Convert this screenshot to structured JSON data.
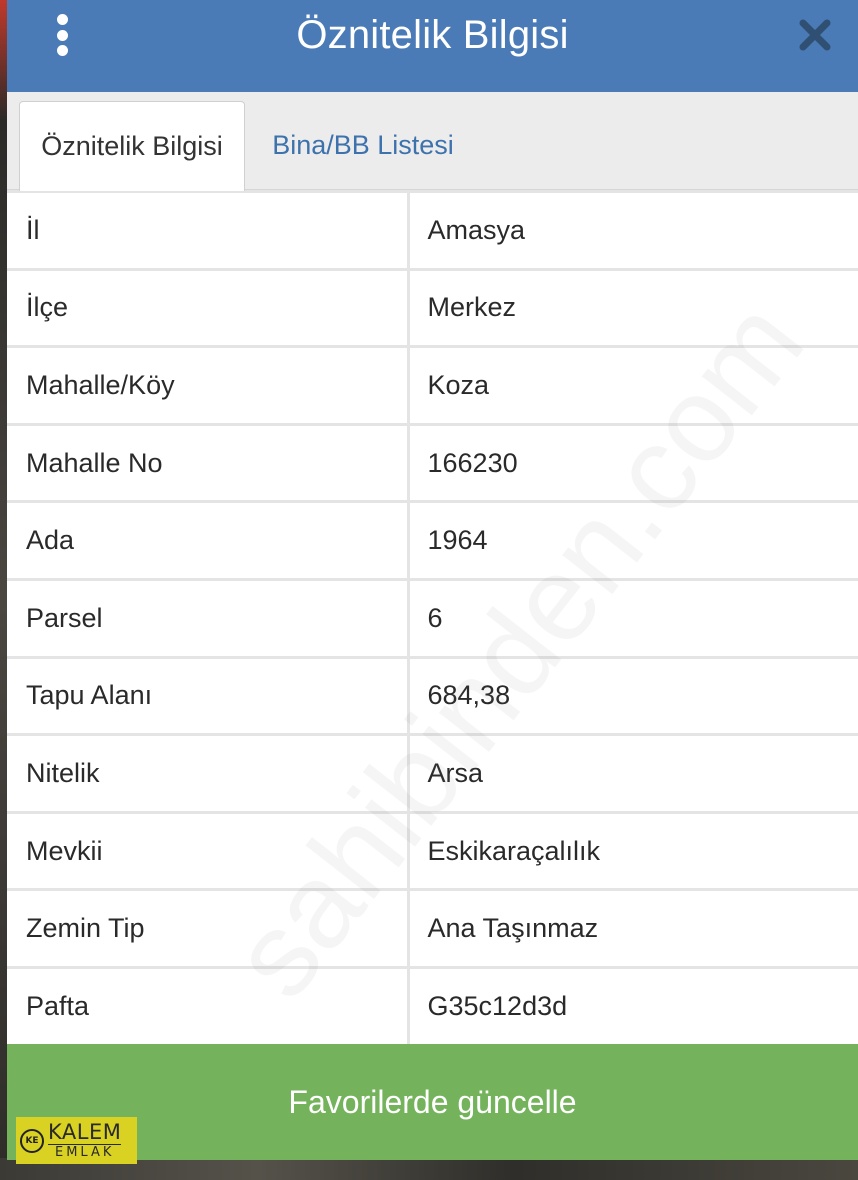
{
  "header": {
    "title": "Öznitelik Bilgisi",
    "menu_icon": "more-vertical-icon",
    "close_icon": "close-icon"
  },
  "tabs": [
    {
      "label": "Öznitelik Bilgisi",
      "active": true
    },
    {
      "label": "Bina/BB Listesi",
      "active": false
    }
  ],
  "attributes": [
    {
      "key": "İl",
      "value": "Amasya"
    },
    {
      "key": "İlçe",
      "value": "Merkez"
    },
    {
      "key": "Mahalle/Köy",
      "value": "Koza"
    },
    {
      "key": "Mahalle No",
      "value": "166230"
    },
    {
      "key": "Ada",
      "value": "1964"
    },
    {
      "key": "Parsel",
      "value": "6"
    },
    {
      "key": "Tapu Alanı",
      "value": "684,38"
    },
    {
      "key": "Nitelik",
      "value": "Arsa"
    },
    {
      "key": "Mevkii",
      "value": "Eskikaraçalılık"
    },
    {
      "key": "Zemin Tip",
      "value": "Ana Taşınmaz"
    },
    {
      "key": "Pafta",
      "value": "G35c12d3d"
    }
  ],
  "footer": {
    "button_label": "Favorilerde güncelle"
  },
  "logo": {
    "mark": "KE",
    "top": "KALEM",
    "bottom": "EMLAK"
  },
  "watermark": "sahibinden.com",
  "colors": {
    "header": "#4a7bb7",
    "tab_link": "#3d72ad",
    "button": "#74b35c",
    "logo_bg": "#d9d223"
  }
}
